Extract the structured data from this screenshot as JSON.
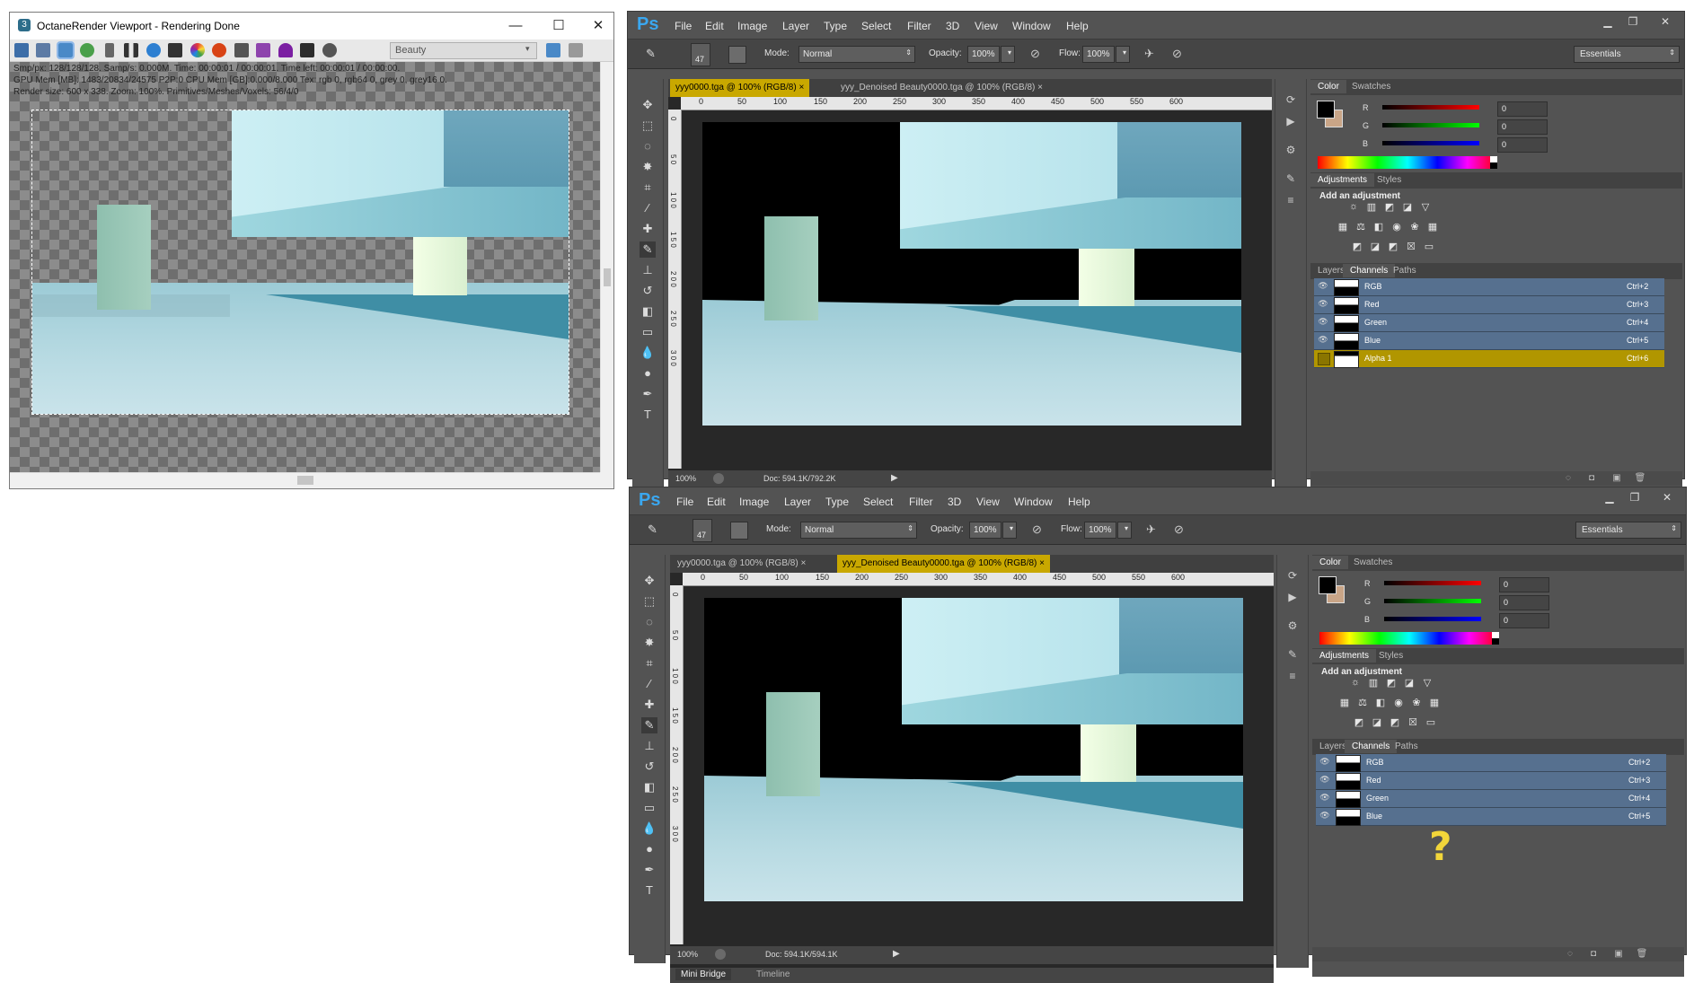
{
  "octane": {
    "title": "OctaneRender Viewport - Rendering Done",
    "logo_char": "3",
    "minimize": "—",
    "maximize": "☐",
    "close": "✕",
    "pass_select": "Beauty",
    "stats": {
      "line1": "Smp/px: 128/128/128.   Samp/s: 0.000M.   Time: 00:00:01 / 00:00:01.   Time left: 00:00:01 / 00:00:00.",
      "line2": "GPU Mem [MB]: 1483/20834/24575 P2P:0   CPU Mem [GB]:0.000/8.000   Tex: rgb 0, rgb64 0, grey 0, grey16 0.",
      "line3": "Render size: 600 x 338.   Zoom: 100%.   Primitives/Meshes/Voxels: 56/4/0"
    },
    "toolbar_icons": [
      "export-icon",
      "copy-icon",
      "quick-render-icon",
      "refresh-icon",
      "lock-icon",
      "pause-icon",
      "restart-icon",
      "aperture-icon",
      "color-icon",
      "region-icon",
      "film-icon",
      "film-region-icon",
      "renderer-icon",
      "material-icon",
      "settings-icon"
    ],
    "toolbar_colors": [
      "#3d6ea8",
      "#5d7ba5",
      "#4a89c7",
      "#4ba04b",
      "#666666",
      "#444444",
      "#2d7fd1",
      "#333333",
      "#c0392b",
      "#d84315",
      "#555555",
      "#8e44ad",
      "#7b1fa2",
      "#2c2c2c",
      "#555555"
    ]
  },
  "ps_common": {
    "logo": "Ps",
    "menu": [
      "File",
      "Edit",
      "Image",
      "Layer",
      "Type",
      "Select",
      "Filter",
      "3D",
      "View",
      "Window",
      "Help"
    ],
    "mode_label": "Mode:",
    "mode_value": "Normal",
    "opacity_label": "Opacity:",
    "opacity_value": "100%",
    "flow_label": "Flow:",
    "flow_value": "100%",
    "brush_size": "47",
    "workspace": "Essentials",
    "ruler_h": [
      "0",
      "50",
      "100",
      "150",
      "200",
      "250",
      "300",
      "350",
      "400",
      "450",
      "500",
      "550",
      "600"
    ],
    "ruler_v": [
      "0",
      "5 0",
      "1 0 0",
      "1 5 0",
      "2 0 0",
      "2 5 0",
      "3 0 0"
    ],
    "zoom": "100%",
    "minibridge": "Mini Bridge",
    "timeline": "Timeline",
    "color_tab": "Color",
    "swatches_tab": "Swatches",
    "adjustments_tab": "Adjustments",
    "styles_tab": "Styles",
    "add_adjustment": "Add an adjustment",
    "layers_tab": "Layers",
    "channels_tab": "Channels",
    "paths_tab": "Paths",
    "r_label": "R",
    "g_label": "G",
    "b_label": "B",
    "r_val": "0",
    "g_val": "0",
    "b_val": "0"
  },
  "ps1": {
    "tab1": "yyy0000.tga @ 100% (RGB/8)",
    "tab2": "yyy_Denoised Beauty0000.tga @ 100% (RGB/8)",
    "doc_info": "Doc: 594.1K/792.2K",
    "channels": [
      {
        "name": "RGB",
        "shortcut": "Ctrl+2"
      },
      {
        "name": "Red",
        "shortcut": "Ctrl+3"
      },
      {
        "name": "Green",
        "shortcut": "Ctrl+4"
      },
      {
        "name": "Blue",
        "shortcut": "Ctrl+5"
      },
      {
        "name": "Alpha 1",
        "shortcut": "Ctrl+6"
      }
    ]
  },
  "ps2": {
    "tab1": "yyy0000.tga @ 100% (RGB/8)",
    "tab2": "yyy_Denoised Beauty0000.tga @ 100% (RGB/8)",
    "doc_info": "Doc: 594.1K/594.1K",
    "channels": [
      {
        "name": "RGB",
        "shortcut": "Ctrl+2"
      },
      {
        "name": "Red",
        "shortcut": "Ctrl+3"
      },
      {
        "name": "Green",
        "shortcut": "Ctrl+4"
      },
      {
        "name": "Blue",
        "shortcut": "Ctrl+5"
      }
    ],
    "annotation": "?"
  }
}
